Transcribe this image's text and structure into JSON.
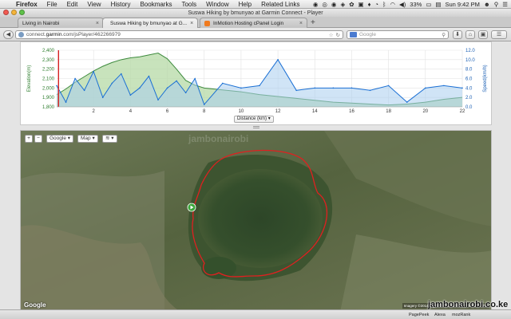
{
  "menubar": {
    "apple_label": "",
    "items": [
      "Firefox",
      "File",
      "Edit",
      "View",
      "History",
      "Bookmarks",
      "Tools",
      "Window",
      "Help",
      "Related Links"
    ],
    "battery": "33%",
    "clock": "Sun 9:42 PM"
  },
  "window": {
    "title": "Suswa Hiking by bmunyao at Garmin Connect - Player"
  },
  "tabs": [
    {
      "label": "Living in Nairobi",
      "active": false
    },
    {
      "label": "Suswa Hiking by bmunyao at G...",
      "active": true
    },
    {
      "label": "InMotion Hosting cPanel Login",
      "active": false
    }
  ],
  "new_tab_label": "+",
  "navbar": {
    "url_host": "connect.garmin.com",
    "url_path": "/jsPlayer/462266979",
    "url_prefix": "connect.",
    "url_domain": "garmin",
    "url_suffix": ".com/jsPlayer/462266979",
    "search_placeholder": "Google",
    "star": "☆"
  },
  "chart_data": {
    "type": "area",
    "x": [
      0.0,
      0.5,
      1.0,
      1.5,
      2.0,
      2.5,
      3.0,
      3.5,
      4.0,
      4.5,
      5.0,
      5.5,
      6.0,
      6.5,
      7.0,
      7.5,
      8.0,
      9.0,
      10.0,
      11.0,
      12.0,
      13.0,
      14.0,
      15.0,
      16.0,
      17.0,
      18.0,
      19.0,
      20.0,
      21.0,
      22.0
    ],
    "series": [
      {
        "name": "Elevation(m)",
        "axis": "left",
        "color": "#3d8a3d",
        "values": [
          1930,
          1990,
          2060,
          2120,
          2180,
          2230,
          2270,
          2300,
          2320,
          2330,
          2350,
          2370,
          2310,
          2200,
          2080,
          2030,
          2000,
          1980,
          1960,
          1930,
          1910,
          1890,
          1870,
          1850,
          1840,
          1830,
          1820,
          1830,
          1850,
          1880,
          1900
        ]
      },
      {
        "name": "Speed(km/h)",
        "axis": "right",
        "color": "#1a6fd4",
        "values": [
          4.5,
          1.0,
          6.0,
          3.5,
          7.5,
          2.0,
          5.0,
          7.0,
          2.5,
          4.0,
          6.5,
          1.5,
          4.0,
          5.5,
          3.0,
          6.0,
          0.5,
          5.0,
          4.0,
          4.5,
          10.0,
          3.5,
          4.0,
          4.0,
          4.0,
          3.5,
          4.5,
          1.0,
          4.0,
          4.5,
          4.0
        ]
      }
    ],
    "xlabel": "Distance (km)",
    "ylabel": "Elevation(m)",
    "y2label": "Speed(km/h)",
    "xlim": [
      0,
      22
    ],
    "ylim": [
      1800,
      2400
    ],
    "y2lim": [
      0,
      12
    ],
    "x_ticks": [
      2,
      4,
      6,
      8,
      10,
      12,
      14,
      16,
      18,
      20,
      22
    ],
    "y_ticks": [
      1800,
      1900,
      2000,
      2100,
      2200,
      2300,
      2400
    ],
    "y2_ticks": [
      0,
      2,
      4,
      6,
      8,
      10,
      12
    ],
    "y2_tick_labels": [
      "0.0",
      "2.0",
      "4.0",
      "6.0",
      "8.0",
      "10.0",
      "12.0"
    ],
    "grid": true,
    "cursor_x": 0.1,
    "cursor_color": "#d42020",
    "select_label": "Distance (km)"
  },
  "map": {
    "zoom_in": "+",
    "zoom_out": "−",
    "provider_label": "Google",
    "type_label": "Map",
    "layers_label": "",
    "logo": "Google",
    "imagery_credit": "Imagery ©2014 DigitalGlobe, Landsat | Terms of Use",
    "watermark": "jambonairobi",
    "track_color": "#e02020",
    "start_marker_color": "#3aa63a"
  },
  "statusbar": {
    "addons": [
      "PagePeek",
      "Alexa",
      "mozRank"
    ]
  },
  "site_mark": "jambonairobi.co.ke",
  "colors": {
    "elevation_fill": "#b5d9a5",
    "speed_fill": "#a9cdef"
  }
}
